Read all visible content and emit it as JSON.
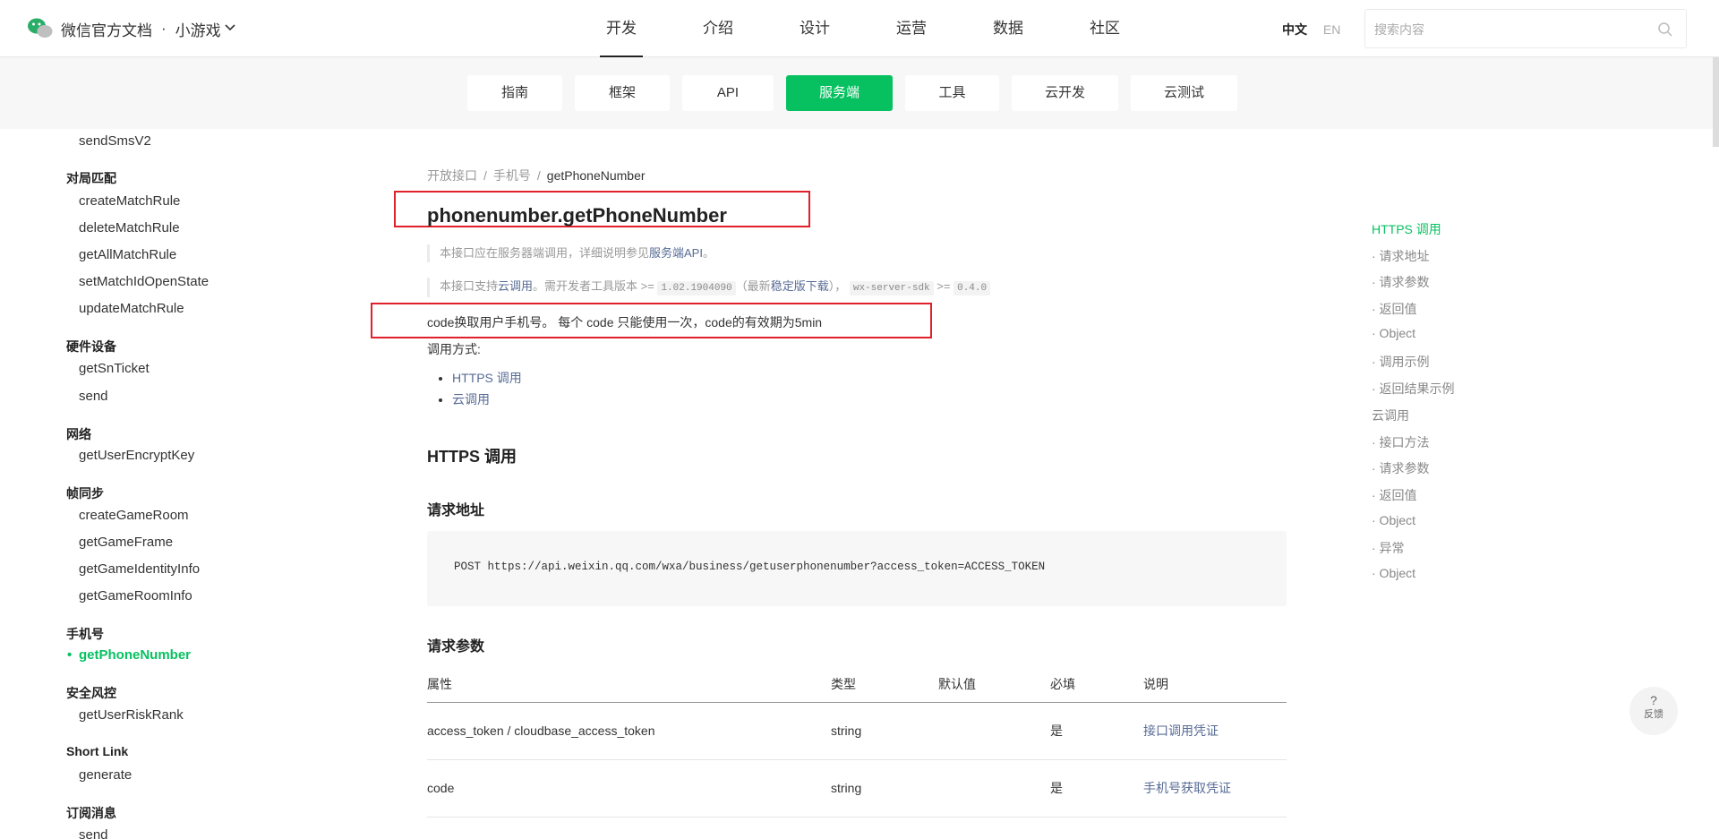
{
  "header": {
    "brand": "微信官方文档",
    "dot": "·",
    "product": "小游戏",
    "nav": [
      "开发",
      "介绍",
      "设计",
      "运营",
      "数据",
      "社区"
    ],
    "lang_zh": "中文",
    "lang_en": "EN",
    "search_placeholder": "搜索内容"
  },
  "subnav": [
    "指南",
    "框架",
    "API",
    "服务端",
    "工具",
    "云开发",
    "云测试"
  ],
  "sidebar": {
    "top_item": "sendSmsV2",
    "g1": "对局匹配",
    "g1_items": [
      "createMatchRule",
      "deleteMatchRule",
      "getAllMatchRule",
      "setMatchIdOpenState",
      "updateMatchRule"
    ],
    "g2": "硬件设备",
    "g2_items": [
      "getSnTicket",
      "send"
    ],
    "g3": "网络",
    "g3_items": [
      "getUserEncryptKey"
    ],
    "g4": "帧同步",
    "g4_items": [
      "createGameRoom",
      "getGameFrame",
      "getGameIdentityInfo",
      "getGameRoomInfo"
    ],
    "g5": "手机号",
    "g5_items": [
      "getPhoneNumber"
    ],
    "g6": "安全风控",
    "g6_items": [
      "getUserRiskRank"
    ],
    "g7": "Short Link",
    "g7_items": [
      "generate"
    ],
    "g8": "订阅消息",
    "g8_items": [
      "send"
    ]
  },
  "main": {
    "crumb1": "开放接口",
    "crumb2": "手机号",
    "crumb3": "getPhoneNumber",
    "sep": "/",
    "title": "phonenumber.getPhoneNumber",
    "note1_pre": "本接口应在服务器端调用，详细说明参见",
    "note1_link": "服务端API",
    "note1_post": "。",
    "note2_pre": "本接口支持",
    "note2_link": "云调用",
    "note2_mid": "。需开发者工具版本 >= ",
    "note2_code1": "1.02.1904090",
    "note2_mid2": "（最新",
    "note2_link2": "稳定版下载",
    "note2_mid3": "），",
    "note2_code2": "wx-server-sdk",
    "note2_mid4": " >= ",
    "note2_code3": "0.4.0",
    "desc": "code换取用户手机号。 每个 code 只能使用一次，code的有效期为5min",
    "call_label": "调用方式:",
    "call_links": [
      "HTTPS 调用",
      "云调用"
    ],
    "h_https": "HTTPS 调用",
    "h_url": "请求地址",
    "code_url": "POST https://api.weixin.qq.com/wxa/business/getuserphonenumber?access_token=ACCESS_TOKEN",
    "h_params": "请求参数",
    "table_headers": [
      "属性",
      "类型",
      "默认值",
      "必填",
      "说明"
    ],
    "rows": [
      [
        "access_token / cloudbase_access_token",
        "string",
        "",
        "是",
        "接口调用凭证"
      ],
      [
        "code",
        "string",
        "",
        "是",
        "手机号获取凭证"
      ]
    ]
  },
  "toc": [
    "HTTPS 调用",
    "· 请求地址",
    "· 请求参数",
    "· 返回值",
    "· Object",
    "· 调用示例",
    "· 返回结果示例",
    "云调用",
    "· 接口方法",
    "· 请求参数",
    "· 返回值",
    "· Object",
    "· 异常",
    "· Object"
  ],
  "feedback": {
    "q": "?",
    "label": "反馈"
  },
  "colors": {
    "accent": "#07c160",
    "link": "#576b95",
    "highlight": "#e0202a"
  }
}
